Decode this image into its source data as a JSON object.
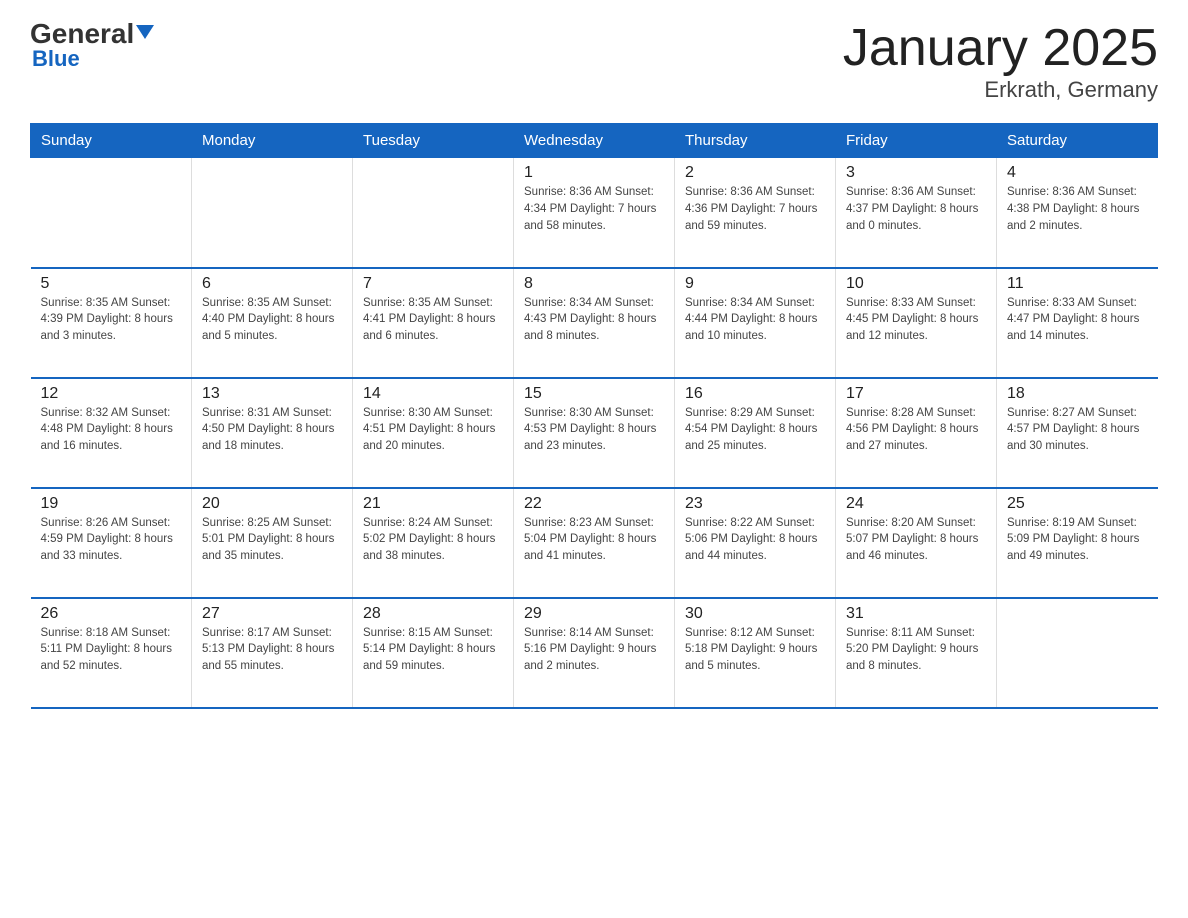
{
  "logo": {
    "general": "General",
    "blue": "Blue"
  },
  "title": "January 2025",
  "subtitle": "Erkrath, Germany",
  "days_of_week": [
    "Sunday",
    "Monday",
    "Tuesday",
    "Wednesday",
    "Thursday",
    "Friday",
    "Saturday"
  ],
  "weeks": [
    [
      {
        "day": "",
        "info": ""
      },
      {
        "day": "",
        "info": ""
      },
      {
        "day": "",
        "info": ""
      },
      {
        "day": "1",
        "info": "Sunrise: 8:36 AM\nSunset: 4:34 PM\nDaylight: 7 hours\nand 58 minutes."
      },
      {
        "day": "2",
        "info": "Sunrise: 8:36 AM\nSunset: 4:36 PM\nDaylight: 7 hours\nand 59 minutes."
      },
      {
        "day": "3",
        "info": "Sunrise: 8:36 AM\nSunset: 4:37 PM\nDaylight: 8 hours\nand 0 minutes."
      },
      {
        "day": "4",
        "info": "Sunrise: 8:36 AM\nSunset: 4:38 PM\nDaylight: 8 hours\nand 2 minutes."
      }
    ],
    [
      {
        "day": "5",
        "info": "Sunrise: 8:35 AM\nSunset: 4:39 PM\nDaylight: 8 hours\nand 3 minutes."
      },
      {
        "day": "6",
        "info": "Sunrise: 8:35 AM\nSunset: 4:40 PM\nDaylight: 8 hours\nand 5 minutes."
      },
      {
        "day": "7",
        "info": "Sunrise: 8:35 AM\nSunset: 4:41 PM\nDaylight: 8 hours\nand 6 minutes."
      },
      {
        "day": "8",
        "info": "Sunrise: 8:34 AM\nSunset: 4:43 PM\nDaylight: 8 hours\nand 8 minutes."
      },
      {
        "day": "9",
        "info": "Sunrise: 8:34 AM\nSunset: 4:44 PM\nDaylight: 8 hours\nand 10 minutes."
      },
      {
        "day": "10",
        "info": "Sunrise: 8:33 AM\nSunset: 4:45 PM\nDaylight: 8 hours\nand 12 minutes."
      },
      {
        "day": "11",
        "info": "Sunrise: 8:33 AM\nSunset: 4:47 PM\nDaylight: 8 hours\nand 14 minutes."
      }
    ],
    [
      {
        "day": "12",
        "info": "Sunrise: 8:32 AM\nSunset: 4:48 PM\nDaylight: 8 hours\nand 16 minutes."
      },
      {
        "day": "13",
        "info": "Sunrise: 8:31 AM\nSunset: 4:50 PM\nDaylight: 8 hours\nand 18 minutes."
      },
      {
        "day": "14",
        "info": "Sunrise: 8:30 AM\nSunset: 4:51 PM\nDaylight: 8 hours\nand 20 minutes."
      },
      {
        "day": "15",
        "info": "Sunrise: 8:30 AM\nSunset: 4:53 PM\nDaylight: 8 hours\nand 23 minutes."
      },
      {
        "day": "16",
        "info": "Sunrise: 8:29 AM\nSunset: 4:54 PM\nDaylight: 8 hours\nand 25 minutes."
      },
      {
        "day": "17",
        "info": "Sunrise: 8:28 AM\nSunset: 4:56 PM\nDaylight: 8 hours\nand 27 minutes."
      },
      {
        "day": "18",
        "info": "Sunrise: 8:27 AM\nSunset: 4:57 PM\nDaylight: 8 hours\nand 30 minutes."
      }
    ],
    [
      {
        "day": "19",
        "info": "Sunrise: 8:26 AM\nSunset: 4:59 PM\nDaylight: 8 hours\nand 33 minutes."
      },
      {
        "day": "20",
        "info": "Sunrise: 8:25 AM\nSunset: 5:01 PM\nDaylight: 8 hours\nand 35 minutes."
      },
      {
        "day": "21",
        "info": "Sunrise: 8:24 AM\nSunset: 5:02 PM\nDaylight: 8 hours\nand 38 minutes."
      },
      {
        "day": "22",
        "info": "Sunrise: 8:23 AM\nSunset: 5:04 PM\nDaylight: 8 hours\nand 41 minutes."
      },
      {
        "day": "23",
        "info": "Sunrise: 8:22 AM\nSunset: 5:06 PM\nDaylight: 8 hours\nand 44 minutes."
      },
      {
        "day": "24",
        "info": "Sunrise: 8:20 AM\nSunset: 5:07 PM\nDaylight: 8 hours\nand 46 minutes."
      },
      {
        "day": "25",
        "info": "Sunrise: 8:19 AM\nSunset: 5:09 PM\nDaylight: 8 hours\nand 49 minutes."
      }
    ],
    [
      {
        "day": "26",
        "info": "Sunrise: 8:18 AM\nSunset: 5:11 PM\nDaylight: 8 hours\nand 52 minutes."
      },
      {
        "day": "27",
        "info": "Sunrise: 8:17 AM\nSunset: 5:13 PM\nDaylight: 8 hours\nand 55 minutes."
      },
      {
        "day": "28",
        "info": "Sunrise: 8:15 AM\nSunset: 5:14 PM\nDaylight: 8 hours\nand 59 minutes."
      },
      {
        "day": "29",
        "info": "Sunrise: 8:14 AM\nSunset: 5:16 PM\nDaylight: 9 hours\nand 2 minutes."
      },
      {
        "day": "30",
        "info": "Sunrise: 8:12 AM\nSunset: 5:18 PM\nDaylight: 9 hours\nand 5 minutes."
      },
      {
        "day": "31",
        "info": "Sunrise: 8:11 AM\nSunset: 5:20 PM\nDaylight: 9 hours\nand 8 minutes."
      },
      {
        "day": "",
        "info": ""
      }
    ]
  ]
}
